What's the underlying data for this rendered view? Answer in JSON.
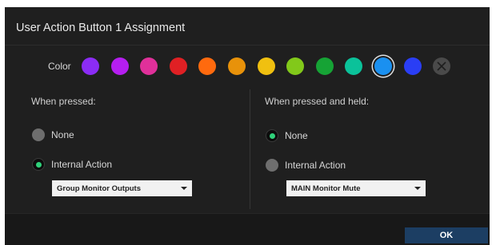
{
  "dialog": {
    "title": "User Action Button 1 Assignment"
  },
  "color": {
    "label": "Color",
    "selected_index": 10,
    "swatches": [
      {
        "name": "violet",
        "hex": "#8b2cf5"
      },
      {
        "name": "purple",
        "hex": "#b51ef0"
      },
      {
        "name": "magenta",
        "hex": "#e0309a"
      },
      {
        "name": "red",
        "hex": "#e02024"
      },
      {
        "name": "orange",
        "hex": "#ff6a0e"
      },
      {
        "name": "amber",
        "hex": "#e8920a"
      },
      {
        "name": "yellow",
        "hex": "#f0c010"
      },
      {
        "name": "lime",
        "hex": "#82c91a"
      },
      {
        "name": "green",
        "hex": "#16a335"
      },
      {
        "name": "teal",
        "hex": "#0bc29a"
      },
      {
        "name": "sky-blue",
        "hex": "#1a90f0"
      },
      {
        "name": "blue",
        "hex": "#2a3ef5"
      },
      {
        "name": "no-color",
        "hex": "#4a4a4a"
      }
    ]
  },
  "pressed": {
    "label": "When pressed:",
    "options": [
      {
        "label": "None",
        "checked": false
      },
      {
        "label": "Internal Action",
        "checked": true
      }
    ],
    "dropdown_value": "Group Monitor Outputs"
  },
  "held": {
    "label": "When pressed and held:",
    "options": [
      {
        "label": "None",
        "checked": true
      },
      {
        "label": "Internal Action",
        "checked": false
      }
    ],
    "dropdown_value": "MAIN Monitor Mute"
  },
  "footer": {
    "ok_label": "OK"
  },
  "icons": {
    "no_color": "x-icon",
    "dropdown": "chevron-down-icon"
  }
}
